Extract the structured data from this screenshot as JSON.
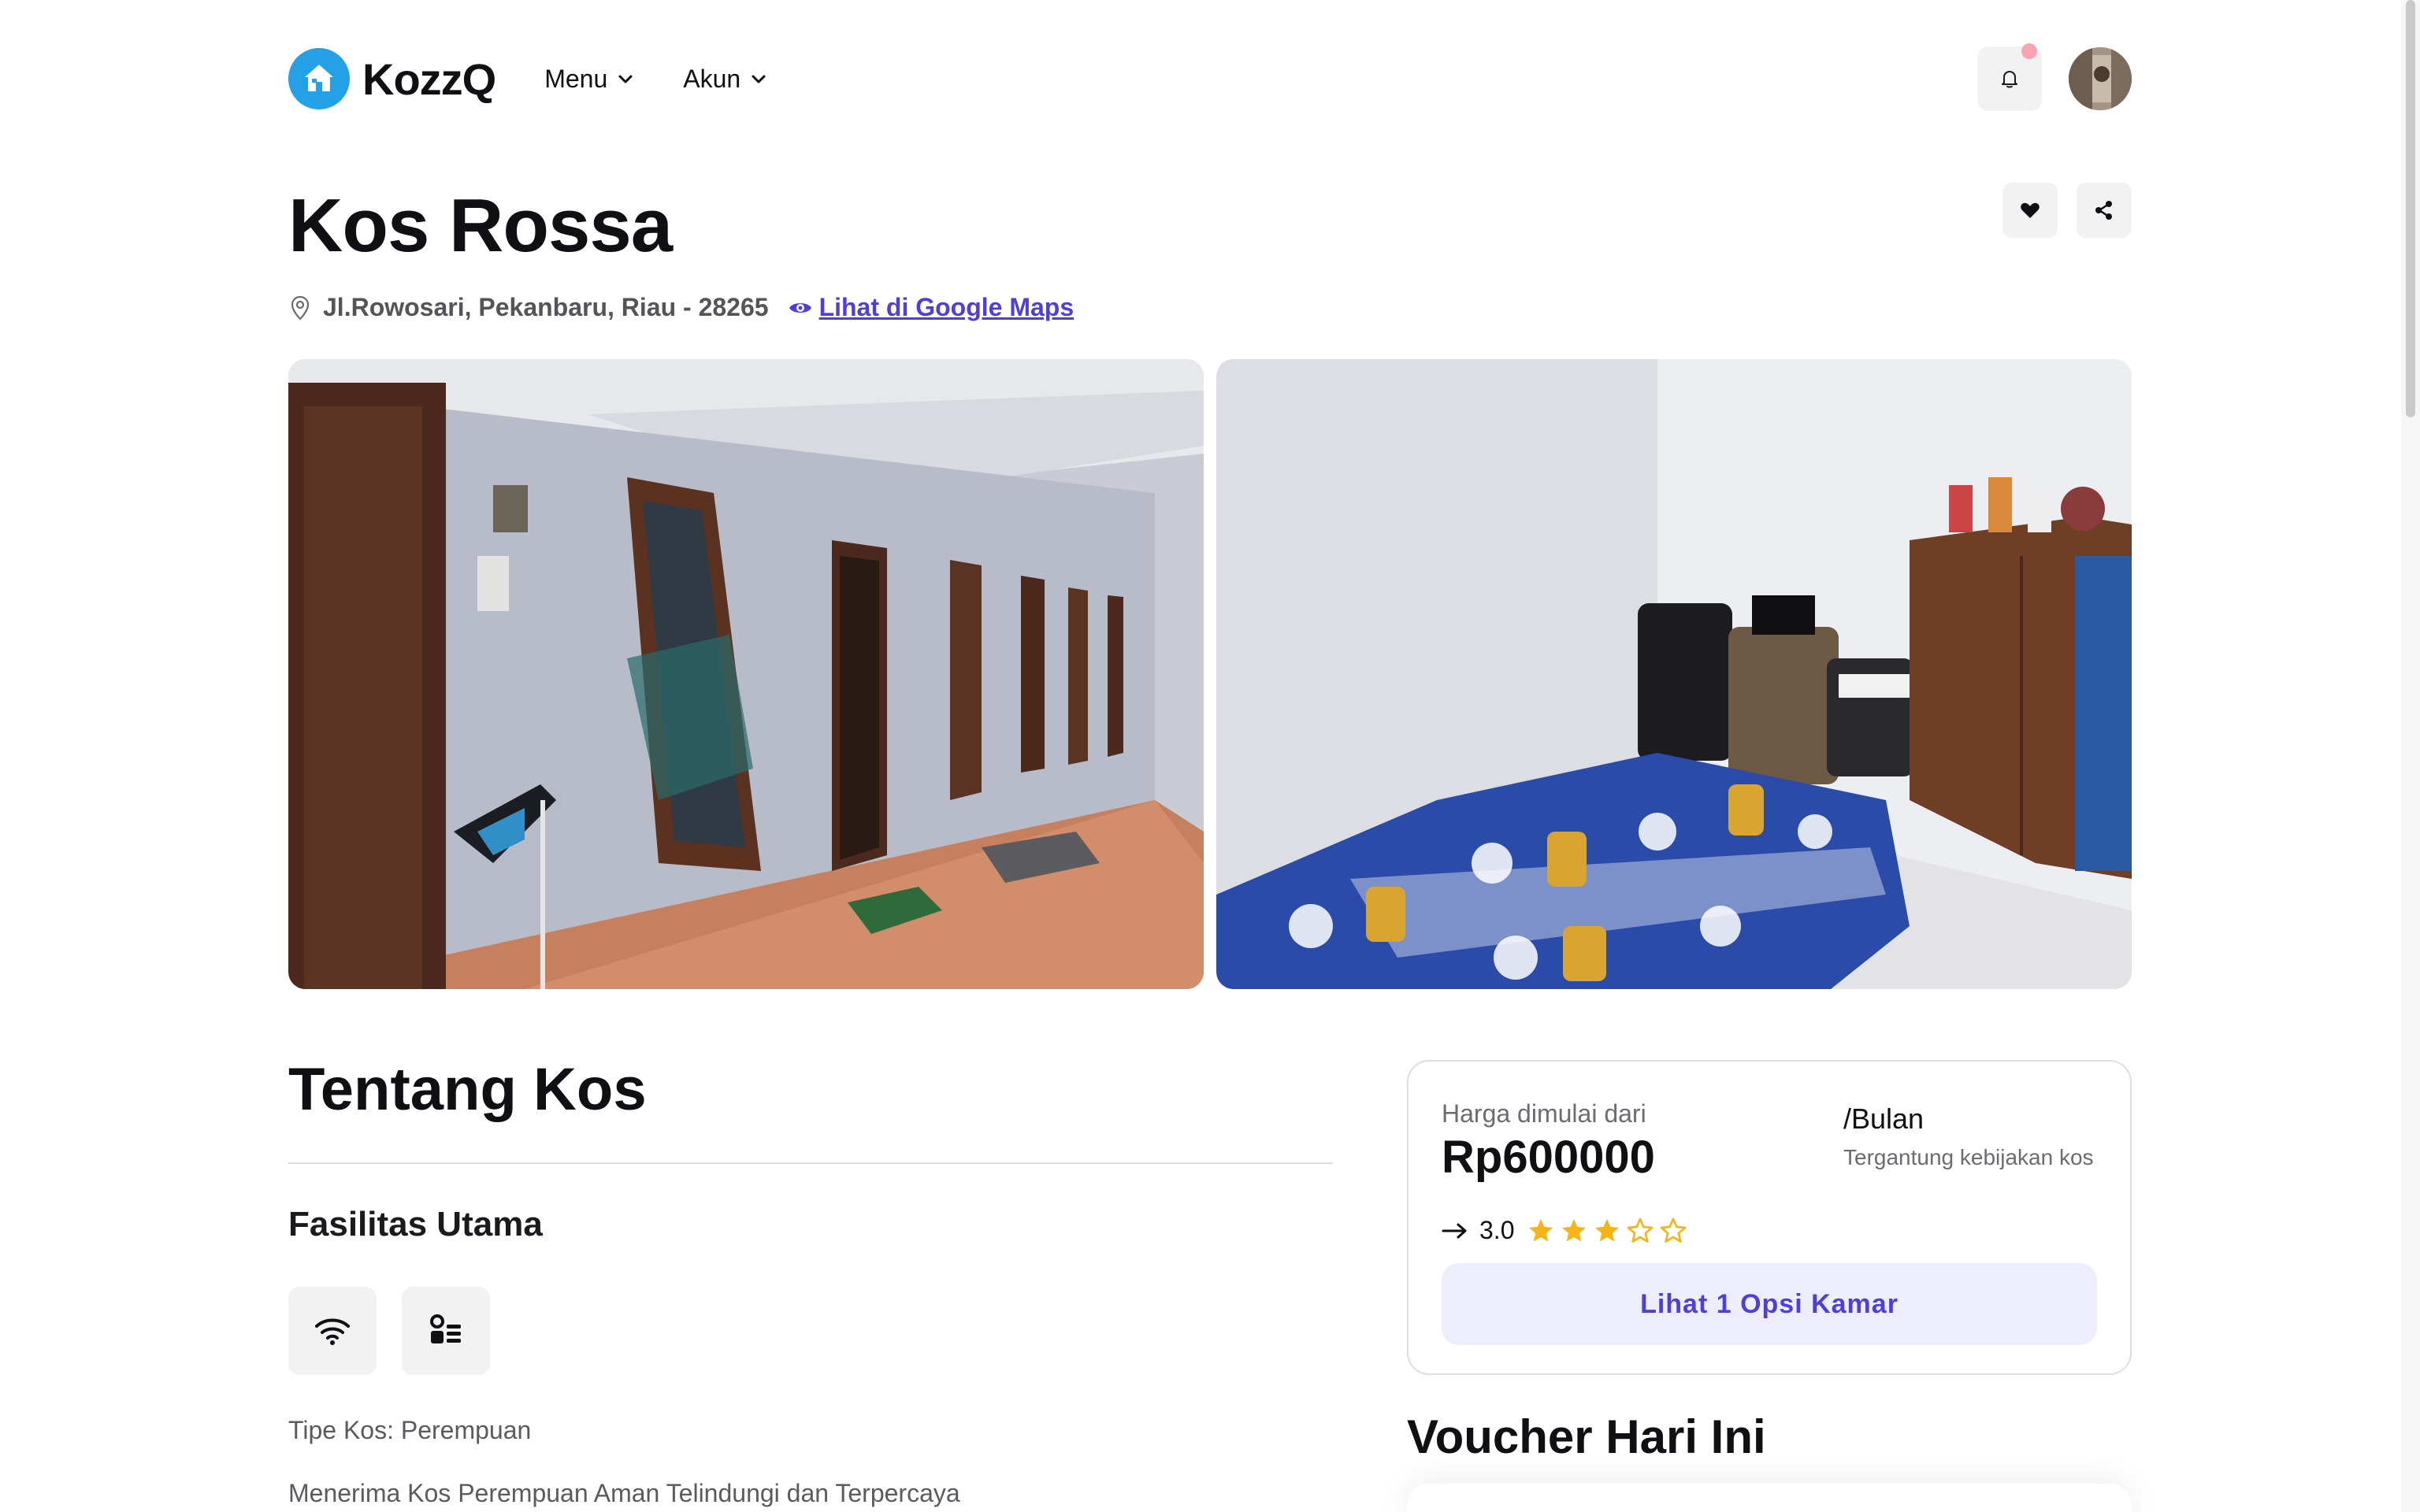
{
  "header": {
    "logo_text": "KozzQ",
    "nav": [
      {
        "label": "Menu"
      },
      {
        "label": "Akun"
      }
    ]
  },
  "property": {
    "title": "Kos Rossa",
    "address": "Jl.Rowosari, Pekanbaru, Riau - 28265",
    "maps_link": "Lihat di Google Maps"
  },
  "about": {
    "title": "Tentang Kos",
    "facilities_title": "Fasilitas Utama",
    "facilities": [
      {
        "icon": "wifi-icon"
      },
      {
        "icon": "amenities-icon"
      }
    ],
    "type": "Tipe Kos: Perempuan",
    "description": "Menerima Kos Perempuan Aman Telindungi dan Terpercaya"
  },
  "pricing": {
    "label": "Harga dimulai dari",
    "price": "Rp600000",
    "period": "/Bulan",
    "period_note": "Tergantung kebijakan kos",
    "rating": "3.0",
    "rating_value": 3,
    "rating_max": 5,
    "button_label": "Lihat 1 Opsi Kamar"
  },
  "voucher": {
    "title": "Voucher Hari Ini"
  },
  "colors": {
    "accent": "#4f3fd9",
    "logo": "#23a0e6",
    "star": "#f5b417",
    "notification_dot": "#f7a5b3"
  }
}
